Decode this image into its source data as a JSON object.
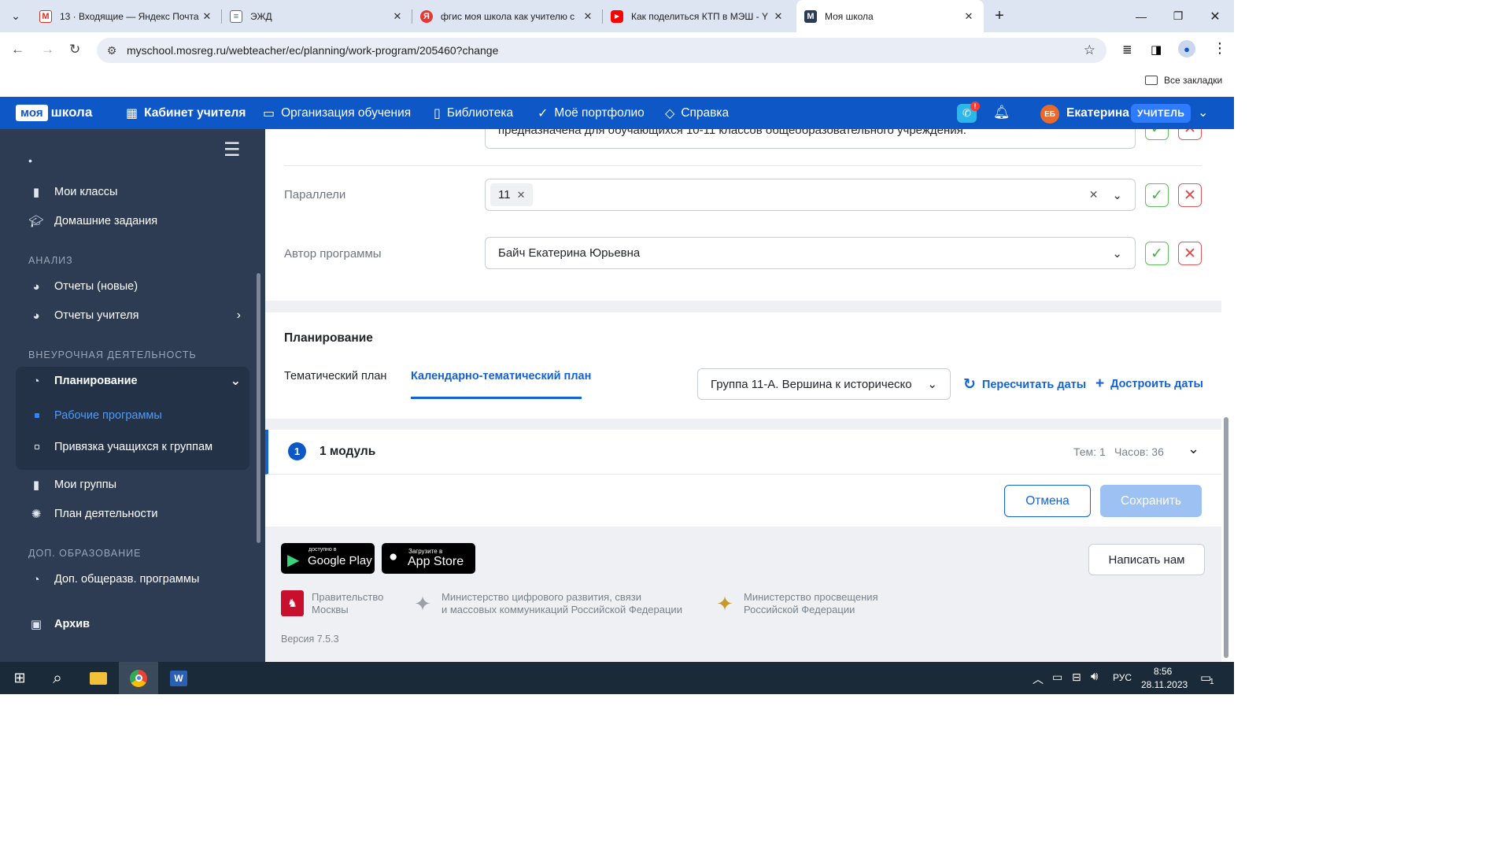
{
  "browser": {
    "tabs": [
      {
        "title": "13 · Входящие — Яндекс Почта",
        "favicon": "gmail-icon"
      },
      {
        "title": "ЭЖД",
        "favicon": "document-icon"
      },
      {
        "title": "фгис моя школа как учителю с",
        "favicon": "yandex-icon"
      },
      {
        "title": "Как поделиться КТП в МЭШ - Y",
        "favicon": "youtube-icon"
      },
      {
        "title": "Моя школа",
        "favicon": "mesh-icon",
        "active": true
      }
    ],
    "url": "myschool.mosreg.ru/webteacher/ec/planning/work-program/205460?change",
    "bookmarks_label": "Все закладки"
  },
  "header": {
    "logo_moya": "моя",
    "logo_shkola": "школа",
    "nav": [
      "Кабинет учителя",
      "Организация обучения",
      "Библиотека",
      "Моё портфолио",
      "Справка"
    ],
    "avatar_initials": "ЕБ",
    "user_name": "Екатерина",
    "role": "УЧИТЕЛЬ"
  },
  "sidebar": {
    "items_top": [
      "Мои классы",
      "Домашние задания"
    ],
    "section_analysis": "АНАЛИЗ",
    "analysis_items": [
      "Отчеты (новые)",
      "Отчеты учителя"
    ],
    "section_extra": "ВНЕУРОЧНАЯ ДЕЯТЕЛЬНОСТЬ",
    "planning": "Планирование",
    "planning_sub": [
      "Рабочие программы",
      "Привязка учащихся к группам"
    ],
    "items_after": [
      "Мои группы",
      "План деятельности"
    ],
    "section_dop": "ДОП. ОБРАЗОВАНИЕ",
    "dop_items": [
      "Доп. общеразв. программы"
    ],
    "archive": "Архив"
  },
  "form": {
    "textarea_tail": "предназначена для обучающихся 10-11 классов общеобразовательного учреждения.",
    "parallels_label": "Параллели",
    "parallels_chip": "11",
    "author_label": "Автор программы",
    "author_value": "Байч Екатерина Юрьевна"
  },
  "planning": {
    "title": "Планирование",
    "tab_thematic": "Тематический план",
    "tab_calendar": "Календарно-тематический план",
    "group_select": "Группа 11-А. Вершина к историческо",
    "recalc": "Пересчитать даты",
    "build": "Достроить даты"
  },
  "module": {
    "number": "1",
    "title": "1 модуль",
    "topics": "Тем: 1",
    "hours": "Часов: 36"
  },
  "actions": {
    "cancel": "Отмена",
    "save": "Сохранить"
  },
  "footer": {
    "gplay_small": "доступно в",
    "gplay_big": "Google Play",
    "appstore_small": "Загрузите в",
    "appstore_big": "App Store",
    "write_us": "Написать нам",
    "org1_l1": "Правительство",
    "org1_l2": "Москвы",
    "org2_l1": "Министерство цифрового развития, связи",
    "org2_l2": "и массовых коммуникаций Российской Федерации",
    "org3_l1": "Министерство просвещения",
    "org3_l2": "Российской Федерации",
    "version": "Версия 7.5.3"
  },
  "taskbar": {
    "lang": "РУС",
    "time": "8:56",
    "date": "28.11.2023",
    "notif_count": "1"
  },
  "colors": {
    "brand": "#0d57c6",
    "sidebar": "#2d3c52",
    "accent": "#1463d6"
  }
}
